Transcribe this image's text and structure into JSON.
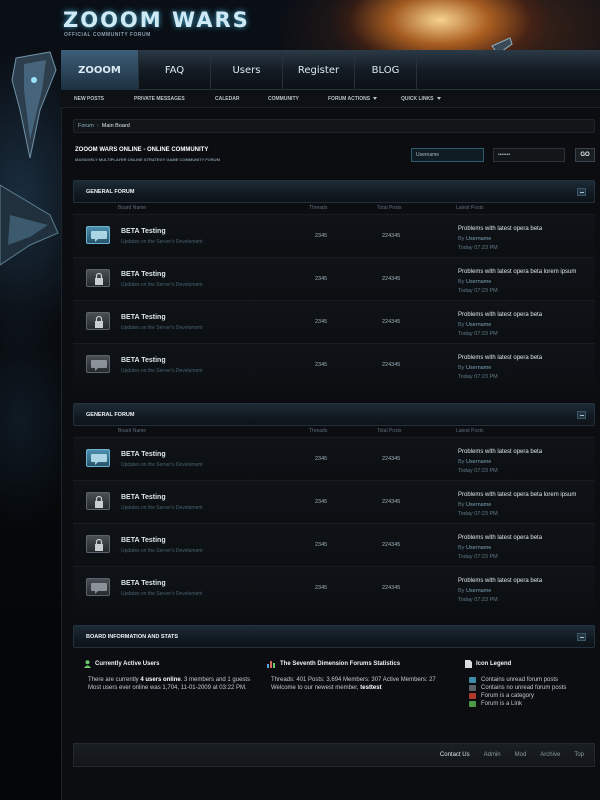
{
  "brand": {
    "logo": "ZOOOM WARS",
    "tagline": "OFFICIAL COMMUNITY FORUM",
    "accent": "#3fa2c8"
  },
  "main_nav": [
    {
      "label": "ZOOOM",
      "icon": "none"
    },
    {
      "label": "FAQ"
    },
    {
      "label": "Users"
    },
    {
      "label": "Register"
    },
    {
      "label": "BLOG"
    }
  ],
  "sub_nav": [
    {
      "label": "NEW POSTS"
    },
    {
      "label": "PRIVATE MESSAGES"
    },
    {
      "label": "CALEDAR"
    },
    {
      "label": "COMMUNITY"
    },
    {
      "label": "FORUM  ACTIONS",
      "dropdown": true
    },
    {
      "label": "QUICK LINKS",
      "dropdown": true
    }
  ],
  "breadcrumb": {
    "root": "Forum",
    "separator": "›",
    "current": "Main Board"
  },
  "site": {
    "title": "ZOOOM WARS  ONLINE  -  ONLINE COMMUNITY",
    "subtitle": "MASSIVELY MULTIPLAYER ONLINE STRATEGY GAME COMMUNITY FORUM"
  },
  "login": {
    "username_value": "Username",
    "password_value": "•••••••",
    "go_label": "GO"
  },
  "columns": {
    "board": "Board  Name",
    "threads": "Threads",
    "posts": "Total Posts",
    "latest": "Latest Posts"
  },
  "sections": [
    {
      "title": "GENERAL FORUM",
      "rows": [
        {
          "status": "new",
          "title": "BETA Testing",
          "desc": "Updates on the Server's Develoment",
          "threads": "2345",
          "posts": "224345",
          "lp_title": "Problems with latest opera beta",
          "lp_by": "By",
          "lp_user": "Username",
          "lp_time": "Today 07:23 PM"
        },
        {
          "status": "locked",
          "title": "BETA Testing",
          "desc": "Updates on the Server's Develoment",
          "threads": "2345",
          "posts": "224345",
          "lp_title": "Problems with latest opera beta lorem ipsum",
          "lp_by": "By",
          "lp_user": "Username",
          "lp_time": "Today 07:23 PM"
        },
        {
          "status": "locked",
          "title": "BETA Testing",
          "desc": "Updates on the Server's Develoment",
          "threads": "2345",
          "posts": "224345",
          "lp_title": "Problems with latest opera beta",
          "lp_by": "By",
          "lp_user": "Username",
          "lp_time": "Today 07:23 PM"
        },
        {
          "status": "read",
          "title": "BETA Testing",
          "desc": "Updates on the Server's Develoment",
          "threads": "2345",
          "posts": "224345",
          "lp_title": "Problems with latest opera beta",
          "lp_by": "By",
          "lp_user": "Username",
          "lp_time": "Today 07:23 PM"
        }
      ]
    },
    {
      "title": "GENERAL FORUM",
      "rows": [
        {
          "status": "new",
          "title": "BETA Testing",
          "desc": "Updates on the Server's Develoment",
          "threads": "2345",
          "posts": "224345",
          "lp_title": "Problems with latest opera beta",
          "lp_by": "By",
          "lp_user": "Username",
          "lp_time": "Today 07:23 PM"
        },
        {
          "status": "locked",
          "title": "BETA Testing",
          "desc": "Updates on the Server's Develoment",
          "threads": "2345",
          "posts": "224345",
          "lp_title": "Problems with latest opera beta lorem ipsum",
          "lp_by": "By",
          "lp_user": "Username",
          "lp_time": "Today 07:23 PM"
        },
        {
          "status": "locked",
          "title": "BETA Testing",
          "desc": "Updates on the Server's Develoment",
          "threads": "2345",
          "posts": "224345",
          "lp_title": "Problems with latest opera beta",
          "lp_by": "By",
          "lp_user": "Username",
          "lp_time": "Today 07:23 PM"
        },
        {
          "status": "read",
          "title": "BETA Testing",
          "desc": "Updates on the Server's Develoment",
          "threads": "2345",
          "posts": "224345",
          "lp_title": "Problems with latest opera beta",
          "lp_by": "By",
          "lp_user": "Username",
          "lp_time": "Today 07:23 PM"
        }
      ]
    }
  ],
  "stats": {
    "header": "BOARD INFORMATION AND STATS",
    "active": {
      "title": "Currently Active Users",
      "line1_pre": "There are currently ",
      "line1_bold": "4 users online",
      "line1_post": ". 3 members and 1 guests",
      "line2": "Most users ever online was 1,704, 11-01-2009 at 03:22 PM."
    },
    "forum_stats": {
      "title": "The Seventh Dimension Forums Statistics",
      "line1": "Threads: 401  Posts: 3,694  Members: 307  Active Members: 27",
      "line2_pre": "Welcome to our newest member, ",
      "line2_bold": "testtest"
    },
    "legend": {
      "title": "Icon Legend",
      "items": [
        {
          "label": "Contains unread forum posts",
          "color": "#3f89a9"
        },
        {
          "label": "Contains no unread forum posts",
          "color": "#5a6067"
        },
        {
          "label": "Forum is a category",
          "color": "#b23a2b"
        },
        {
          "label": "Forum is a Link",
          "color": "#4f9a47"
        }
      ]
    }
  },
  "footer": {
    "links": [
      "Contact Us",
      "Admin",
      "Mod",
      "Archive",
      "Top"
    ]
  }
}
